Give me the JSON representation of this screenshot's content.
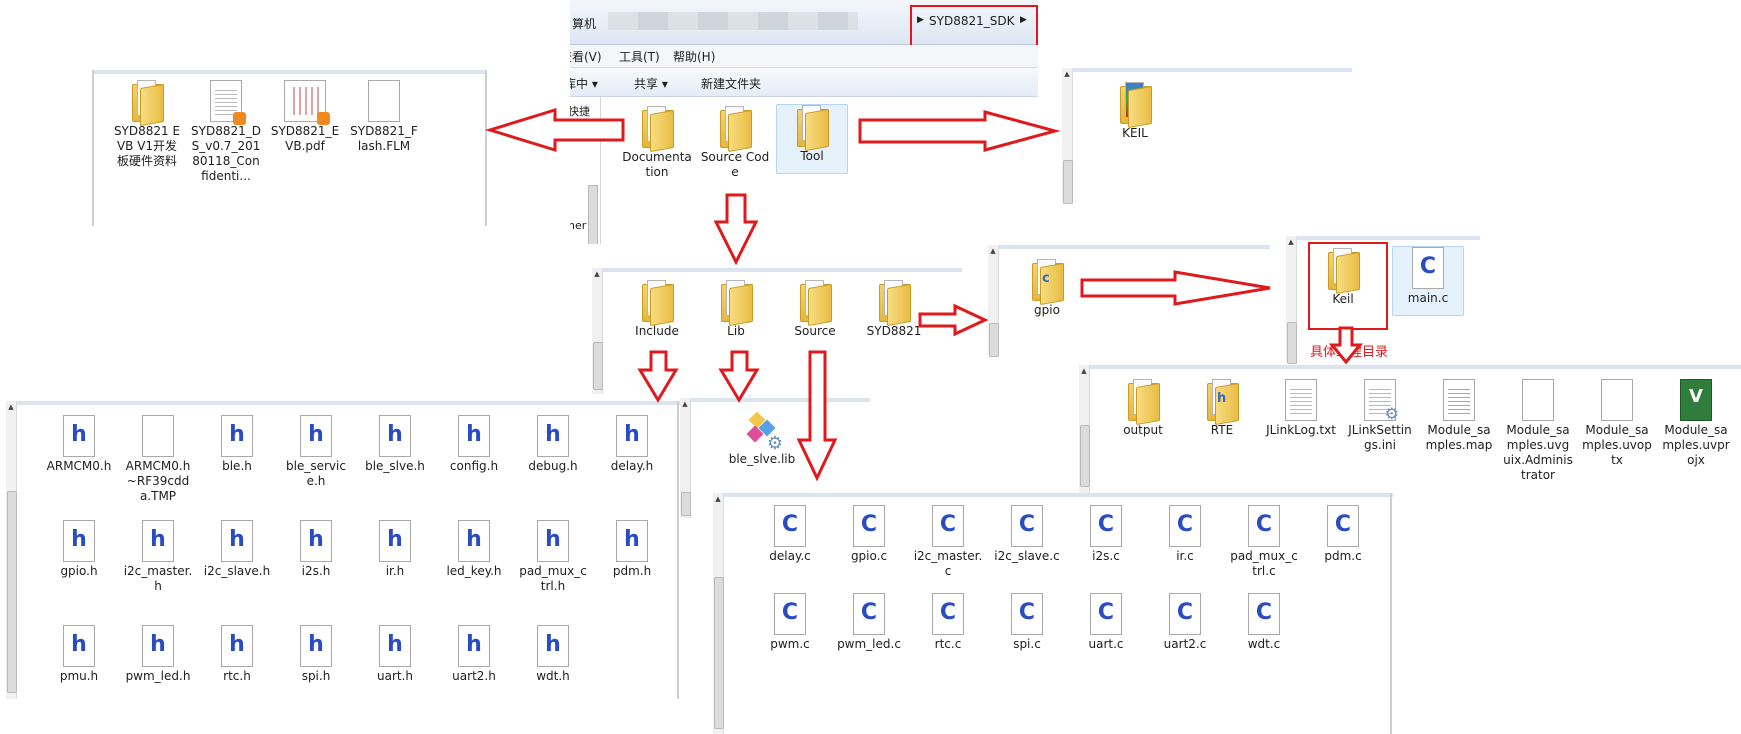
{
  "window": {
    "address_prefix": "算机",
    "address_path": "SYD8821_SDK",
    "menu": [
      "查看(V)",
      "工具(T)",
      "帮助(H)"
    ],
    "toolbar": [
      "库中 ▾",
      "共享 ▾",
      "新建文件夹"
    ],
    "nav_fragments": [
      "快捷",
      "ner"
    ],
    "items": [
      "Documentation",
      "Source Code",
      "Tool"
    ]
  },
  "documentation_folder": {
    "items": [
      "SYD8821 EVB V1开发板硬件资料",
      "SYD8821_DS_v0.7_20180118_Confidenti...",
      "SYD8821_EVB.pdf",
      "SYD8821_Flash.FLM"
    ]
  },
  "tool_folder": {
    "items": [
      "KEIL"
    ]
  },
  "source_code_folder": {
    "items": [
      "Include",
      "Lib",
      "Source",
      "SYD8821"
    ]
  },
  "syd8821_folder": {
    "items": [
      "gpio"
    ]
  },
  "gpio_folder": {
    "items": [
      "Keil",
      "main.c"
    ]
  },
  "keil_annotation": "具体工程目录",
  "keil_folder": {
    "items": [
      "output",
      "RTE",
      "JLinkLog.txt",
      "JLinkSettings.ini",
      "Module_samples.map",
      "Module_samples.uvguix.Administrator",
      "Module_samples.uvoptx",
      "Module_samples.uvprojx"
    ]
  },
  "include_folder": {
    "items": [
      "ARMCM0.h",
      "ARMCM0.h~RF39cdda.TMP",
      "ble.h",
      "ble_service.h",
      "ble_slve.h",
      "config.h",
      "debug.h",
      "delay.h",
      "gpio.h",
      "i2c_master.h",
      "i2c_slave.h",
      "i2s.h",
      "ir.h",
      "led_key.h",
      "pad_mux_ctrl.h",
      "pdm.h",
      "pmu.h",
      "pwm_led.h",
      "rtc.h",
      "spi.h",
      "uart.h",
      "uart2.h",
      "wdt.h"
    ]
  },
  "lib_folder": {
    "items": [
      "ble_slve.lib"
    ]
  },
  "source_folder": {
    "items": [
      "delay.c",
      "gpio.c",
      "i2c_master.c",
      "i2c_slave.c",
      "i2s.c",
      "ir.c",
      "pad_mux_ctrl.c",
      "pdm.c",
      "pwm.c",
      "pwm_led.c",
      "rtc.c",
      "spi.c",
      "uart.c",
      "uart2.c",
      "wdt.c"
    ]
  },
  "colors": {
    "arrow": "#e0191d",
    "folder": "#e9bd45",
    "c_letter": "#2a4cc2",
    "selection": "#e5f1fb"
  }
}
